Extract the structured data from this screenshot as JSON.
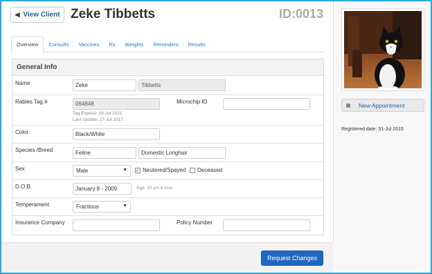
{
  "header": {
    "back_label": "View Client",
    "client_name": "Zeke Tibbetts",
    "client_id": "ID:0013"
  },
  "tabs": [
    {
      "label": "Overview"
    },
    {
      "label": "Consults"
    },
    {
      "label": "Vaccines"
    },
    {
      "label": "Rx"
    },
    {
      "label": "Weights"
    },
    {
      "label": "Reminders"
    },
    {
      "label": "Results"
    }
  ],
  "panel": {
    "title": "General Info",
    "name": {
      "label": "Name",
      "first": "Zeke",
      "last": "Tibbetts"
    },
    "rabies": {
      "label": "Rabies Tag #",
      "value": "094848",
      "expires": "Tag Expires: 29-Jul 2021",
      "updated": "Last Update: 27-Jul 2017"
    },
    "microchip": {
      "label": "Microchip ID",
      "value": ""
    },
    "color": {
      "label": "Color",
      "value": "Black/White"
    },
    "species": {
      "label": "Species /Breed",
      "species": "Feline",
      "breed": "Domestic Longhair"
    },
    "sex": {
      "label": "Sex",
      "value": "Male",
      "neutered_label": "Neutered/Spayed",
      "neutered_checked": true,
      "deceased_label": "Deceased",
      "deceased_checked": false
    },
    "dob": {
      "label": "D.O.B.",
      "value": "January 8 - 2009",
      "age": "Age: 10 yrs 6 mos"
    },
    "temperament": {
      "label": "Temperament",
      "value": "Fractious"
    },
    "insurance": {
      "label": "Insurance Company",
      "value": "",
      "policy_label": "Policy Number",
      "policy_value": ""
    }
  },
  "footer": {
    "submit_label": "Request Changes"
  },
  "sidebar": {
    "appointment_label": "New Appointment",
    "registered": "Registered date: 31-Jul 2015"
  },
  "colors": {
    "accent": "#2ba6dd",
    "button": "#1f68c2",
    "link": "#2a78c6"
  }
}
